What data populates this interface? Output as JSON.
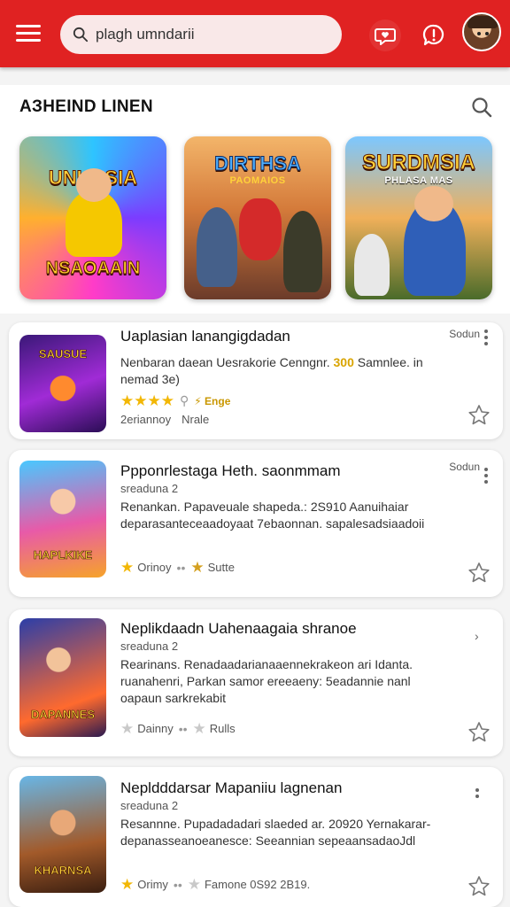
{
  "topbar": {
    "search_value": "plagh umndarii",
    "colors": {
      "bar": "#e02222",
      "search_bg": "#f9e8e8"
    },
    "icons": [
      "menu-icon",
      "search-icon",
      "chat-heart-icon",
      "alert-icon",
      "avatar"
    ]
  },
  "section": {
    "title": "AЗHEIND LINEN"
  },
  "featured": [
    {
      "title": "UNURSIA",
      "subtitle": "NSAOAAIN"
    },
    {
      "title": "DIRTHSA",
      "subtitle": "PAOMAIOS"
    },
    {
      "title": "SURDMSIA",
      "subtitle": "PHLASA MAS"
    }
  ],
  "items": [
    {
      "title": "Uaplasian lanangigdadan",
      "tag": "Sodun",
      "desc_a": "Nenbaran daean Uesrakorie Cenngnr. ",
      "desc_hl": "300",
      "desc_b": " Samnlee. in nemad 3e)",
      "badge": "Enge",
      "rating_label": "2eriannoy",
      "rating_label2": "Nrale",
      "thumb_label": "SAUSUE"
    },
    {
      "title": "Ppponrlestaga Heth. saonmmam",
      "tag": "Sodun",
      "meta": "sreaduna 2",
      "desc": "Renankan. Papaveuale shapeda.: 2S910 Aanuihaiar deparasanteceaadoyaat 7ebaonnan. sapalesadsiaadoii",
      "rating_label": "Orinoy",
      "rating_label2": "Sutte",
      "thumb_label": "HAPLKIKE"
    },
    {
      "title": "Neplikdaadn Uahenaagaia shranoe",
      "meta": "sreaduna 2",
      "desc": "Rearinans. Renadaadarianaaennekrakeon ari Idanta. ruanahenri, Parkan samor ereeaeny: 5eadannie nanl oapaun sarkrekabit",
      "rating_label": "Dainny",
      "rating_label2": "Rulls",
      "thumb_label": "DAPANNES"
    },
    {
      "title": "Nepldddarsar Mapaniiu lagnenan",
      "meta": "sreaduna 2",
      "desc": "Resannne. Pupadadadari slaeded ar. 20920 Yernakarar-depanasseanoeanesce: Seeannian sepeaansadaoJdl",
      "rating_label": "Orimy",
      "rating_label2": "Famone  0S92 2B19.",
      "thumb_label": "KHARNSA"
    }
  ]
}
